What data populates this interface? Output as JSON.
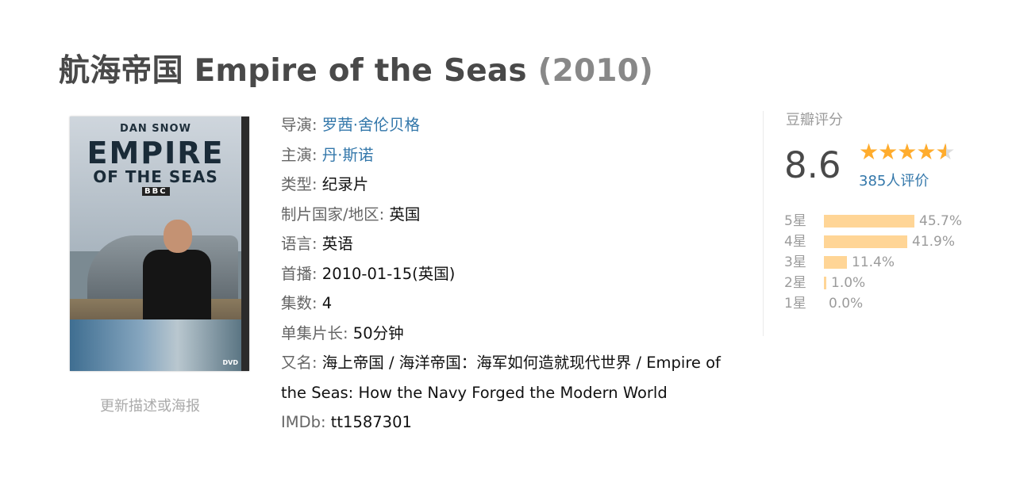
{
  "title": {
    "name": "航海帝国 Empire of the Seas",
    "year": "(2010)"
  },
  "poster": {
    "author": "DAN SNOW",
    "line1": "EMPIRE",
    "line2": "OF THE SEAS",
    "logo": "BBC",
    "format": "DVD"
  },
  "update_link": "更新描述或海报",
  "info": {
    "director": {
      "label": "导演:",
      "value": "罗茜·舍伦贝格"
    },
    "cast": {
      "label": "主演:",
      "value": "丹·斯诺"
    },
    "genre": {
      "label": "类型:",
      "value": "纪录片"
    },
    "country": {
      "label": "制片国家/地区:",
      "value": "英国"
    },
    "language": {
      "label": "语言:",
      "value": "英语"
    },
    "premiere": {
      "label": "首播:",
      "value": "2010-01-15(英国)"
    },
    "episodes": {
      "label": "集数:",
      "value": "4"
    },
    "runtime": {
      "label": "单集片长:",
      "value": "50分钟"
    },
    "aka": {
      "label": "又名:",
      "value": "海上帝国 / 海洋帝国：海军如何造就现代世界 / Empire of the Seas: How the Navy Forged the Modern World"
    },
    "imdb": {
      "label": "IMDb:",
      "value": "tt1587301"
    }
  },
  "rating": {
    "title": "豆瓣评分",
    "score": "8.6",
    "stars_icon": "star-icon",
    "star_value": 4.5,
    "votes": "385人评价",
    "bar_color": "#ffd596",
    "star_color": "#ffac2d",
    "distribution": [
      {
        "label": "5星",
        "percent": "45.7%",
        "value": 45.7
      },
      {
        "label": "4星",
        "percent": "41.9%",
        "value": 41.9
      },
      {
        "label": "3星",
        "percent": "11.4%",
        "value": 11.4
      },
      {
        "label": "2星",
        "percent": "1.0%",
        "value": 1.0
      },
      {
        "label": "1星",
        "percent": "0.0%",
        "value": 0.0
      }
    ]
  }
}
